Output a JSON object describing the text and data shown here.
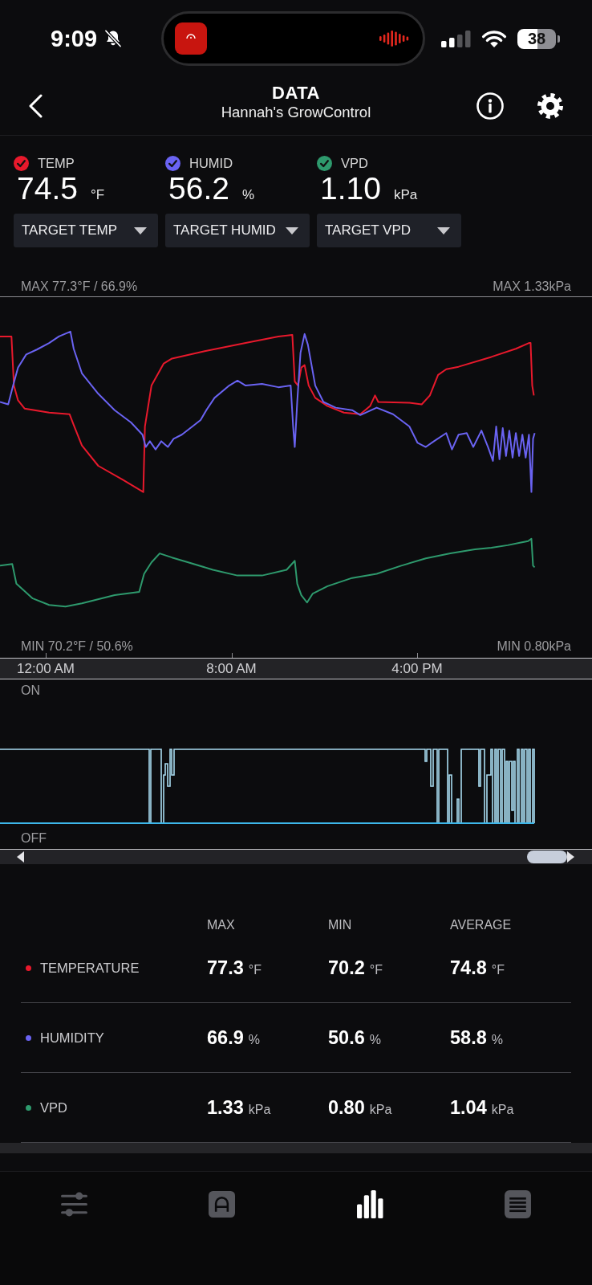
{
  "status_bar": {
    "time": "9:09",
    "battery": "38"
  },
  "header": {
    "title": "DATA",
    "subtitle": "Hannah's GrowControl"
  },
  "readings": [
    {
      "label": "TEMP",
      "checked": true,
      "color": "#e8192c",
      "value": "74.5",
      "unit": "°F",
      "target": "TARGET TEMP"
    },
    {
      "label": "HUMID",
      "checked": true,
      "color": "#6a63f2",
      "value": "56.2",
      "unit": "%",
      "target": "TARGET HUMID"
    },
    {
      "label": "VPD",
      "checked": true,
      "color": "#2e9a6d",
      "value": "1.10",
      "unit": "kPa",
      "target": "TARGET VPD"
    }
  ],
  "chart": {
    "max_left": "MAX 77.3°F / 66.9%",
    "max_right": "MAX 1.33kPa",
    "min_left": "MIN 70.2°F / 50.6%",
    "min_right": "MIN 0.80kPa",
    "time_ticks": [
      "12:00 AM",
      "8:00 AM",
      "4:00 PM"
    ]
  },
  "switch_chart": {
    "on_label": "ON",
    "off_label": "OFF"
  },
  "stats": {
    "columns": [
      "MAX",
      "MIN",
      "AVERAGE"
    ],
    "rows": [
      {
        "name": "TEMPERATURE",
        "color": "#e8192c",
        "cells": [
          {
            "value": "77.3",
            "unit": "°F"
          },
          {
            "value": "70.2",
            "unit": "°F"
          },
          {
            "value": "74.8",
            "unit": "°F"
          }
        ]
      },
      {
        "name": "HUMIDITY",
        "color": "#6a63f2",
        "cells": [
          {
            "value": "66.9",
            "unit": "%"
          },
          {
            "value": "50.6",
            "unit": "%"
          },
          {
            "value": "58.8",
            "unit": "%"
          }
        ]
      },
      {
        "name": "VPD",
        "color": "#2e9a6d",
        "cells": [
          {
            "value": "1.33",
            "unit": "kPa"
          },
          {
            "value": "0.80",
            "unit": "kPa"
          },
          {
            "value": "1.04",
            "unit": "kPa"
          }
        ]
      }
    ]
  },
  "nav": [
    {
      "kind": "sliders",
      "selected": false
    },
    {
      "kind": "arch",
      "selected": false
    },
    {
      "kind": "bars",
      "selected": true
    },
    {
      "kind": "list",
      "selected": false
    }
  ]
}
